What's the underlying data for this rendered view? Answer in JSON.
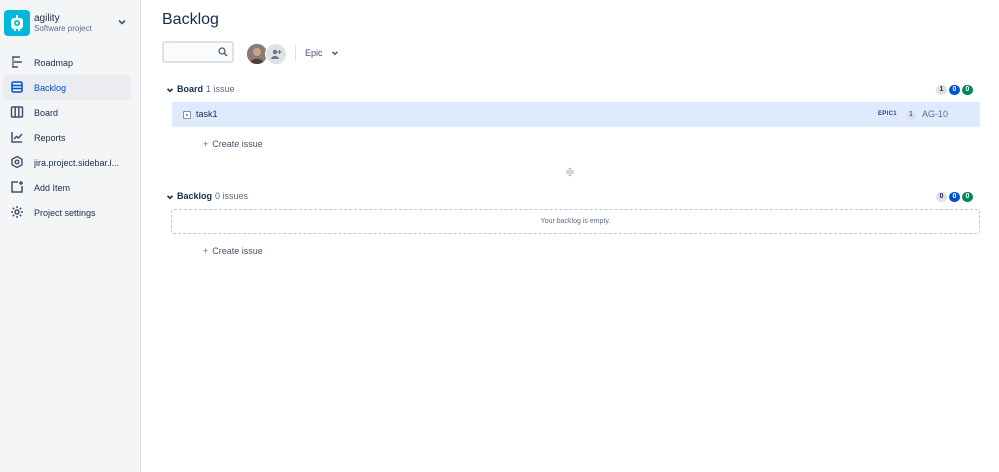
{
  "project": {
    "name": "agility",
    "type": "Software project",
    "avatar_icon": "robot-icon",
    "brand_color": "#00b8d9"
  },
  "sidebar": {
    "items": [
      {
        "label": "Roadmap",
        "icon": "roadmap-icon",
        "active": false
      },
      {
        "label": "Backlog",
        "icon": "backlog-icon",
        "active": true
      },
      {
        "label": "Board",
        "icon": "board-icon",
        "active": false
      },
      {
        "label": "Reports",
        "icon": "reports-icon",
        "active": false
      },
      {
        "label": "jira.project.sidebar.l...",
        "icon": "component-icon",
        "active": false
      },
      {
        "label": "Add Item",
        "icon": "add-item-icon",
        "active": false
      },
      {
        "label": "Project settings",
        "icon": "gear-icon",
        "active": false
      }
    ]
  },
  "page": {
    "title": "Backlog"
  },
  "toolbar": {
    "search_value": "",
    "epic_label": "Epic"
  },
  "sprint": {
    "name": "Board",
    "count": "1 issue",
    "badges": [
      "1",
      "0",
      "0"
    ],
    "issues": [
      {
        "title": "task1",
        "epic": "EPIC1",
        "estimate": "1",
        "key": "AG-10"
      }
    ],
    "create_label": "Create issue"
  },
  "backlog": {
    "name": "Backlog",
    "count": "0 issues",
    "badges": [
      "0",
      "0",
      "0"
    ],
    "empty_text": "Your backlog is empty.",
    "create_label": "Create issue"
  },
  "colors": {
    "accent": "#0052cc",
    "selected_row": "#deebff",
    "done": "#00875a"
  }
}
